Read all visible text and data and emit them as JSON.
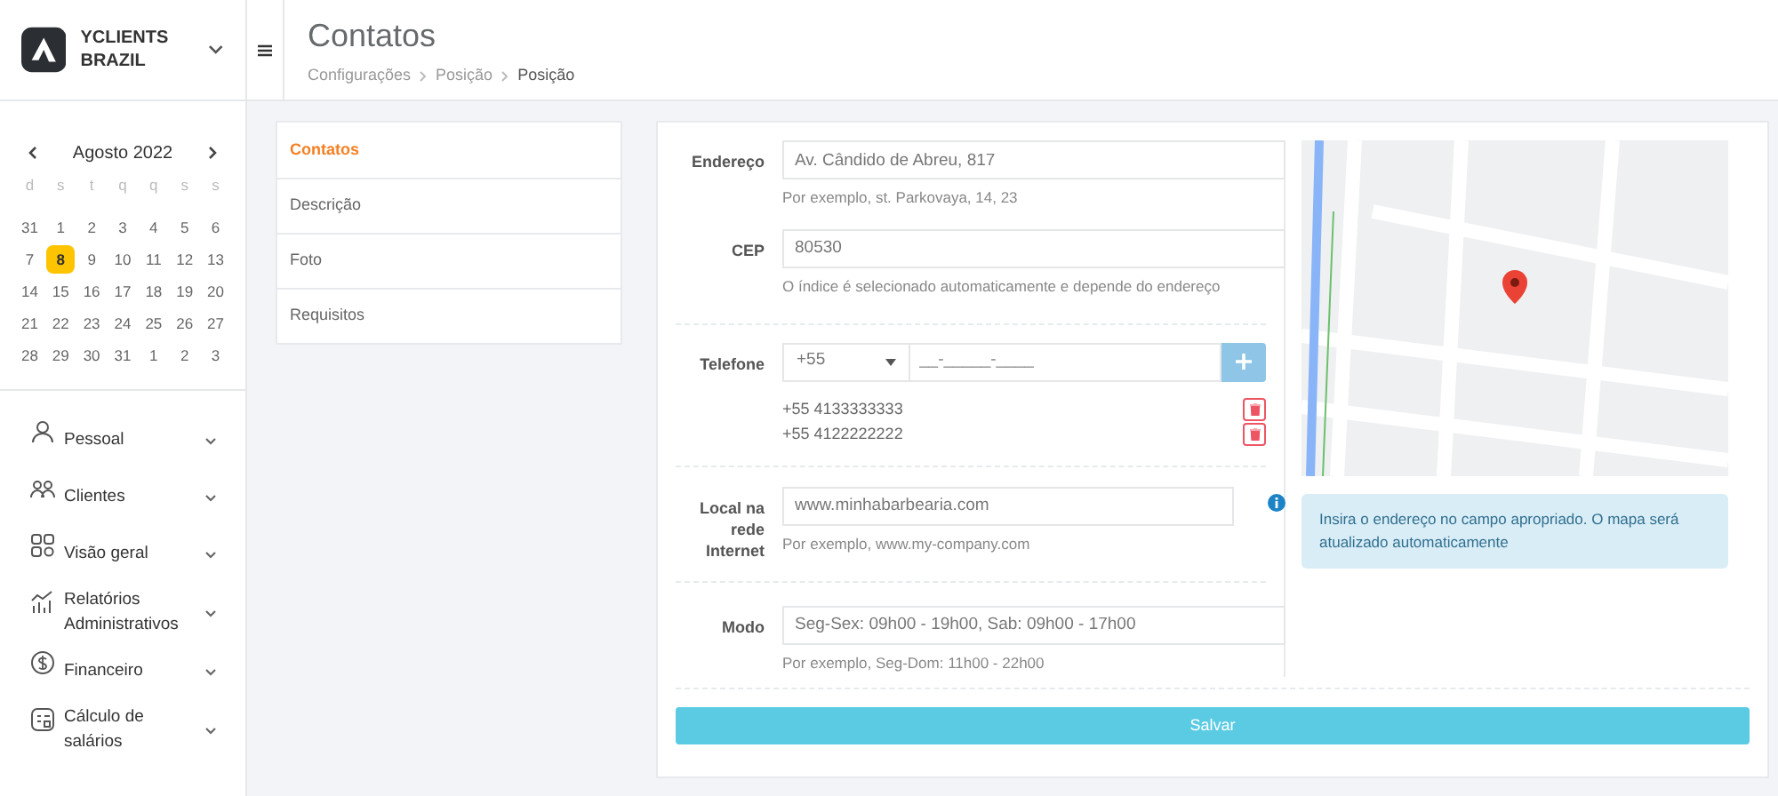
{
  "brand": {
    "name": "YCLIENTS BRAZIL"
  },
  "header": {
    "title": "Contatos",
    "breadcrumbs": [
      "Configurações",
      "Posição",
      "Posição"
    ]
  },
  "calendar": {
    "month": "Agosto 2022",
    "weekdays": [
      "d",
      "s",
      "t",
      "q",
      "q",
      "s",
      "s"
    ],
    "weeks": [
      [
        {
          "d": "31",
          "selected": false
        },
        {
          "d": "1",
          "selected": false
        },
        {
          "d": "2",
          "selected": false
        },
        {
          "d": "3",
          "selected": false
        },
        {
          "d": "4",
          "selected": false
        },
        {
          "d": "5",
          "selected": false
        },
        {
          "d": "6",
          "selected": false
        }
      ],
      [
        {
          "d": "7",
          "selected": false
        },
        {
          "d": "8",
          "selected": true
        },
        {
          "d": "9",
          "selected": false
        },
        {
          "d": "10",
          "selected": false
        },
        {
          "d": "11",
          "selected": false
        },
        {
          "d": "12",
          "selected": false
        },
        {
          "d": "13",
          "selected": false
        }
      ],
      [
        {
          "d": "14",
          "selected": false
        },
        {
          "d": "15",
          "selected": false
        },
        {
          "d": "16",
          "selected": false
        },
        {
          "d": "17",
          "selected": false
        },
        {
          "d": "18",
          "selected": false
        },
        {
          "d": "19",
          "selected": false
        },
        {
          "d": "20",
          "selected": false
        }
      ],
      [
        {
          "d": "21",
          "selected": false
        },
        {
          "d": "22",
          "selected": false
        },
        {
          "d": "23",
          "selected": false
        },
        {
          "d": "24",
          "selected": false
        },
        {
          "d": "25",
          "selected": false
        },
        {
          "d": "26",
          "selected": false
        },
        {
          "d": "27",
          "selected": false
        }
      ],
      [
        {
          "d": "28",
          "selected": false
        },
        {
          "d": "29",
          "selected": false
        },
        {
          "d": "30",
          "selected": false
        },
        {
          "d": "31",
          "selected": false
        },
        {
          "d": "1",
          "selected": false
        },
        {
          "d": "2",
          "selected": false
        },
        {
          "d": "3",
          "selected": false
        }
      ]
    ]
  },
  "sidebar": {
    "items": [
      {
        "label": "Pessoal"
      },
      {
        "label": "Clientes"
      },
      {
        "label": "Visão geral"
      },
      {
        "label": "Relatórios Administrativos"
      },
      {
        "label": "Financeiro"
      },
      {
        "label": "Cálculo de salários"
      }
    ]
  },
  "tabs": [
    {
      "label": "Contatos",
      "selected": true
    },
    {
      "label": "Descrição",
      "selected": false
    },
    {
      "label": "Foto",
      "selected": false
    },
    {
      "label": "Requisitos",
      "selected": false
    }
  ],
  "form": {
    "address": {
      "label": "Endereço",
      "value": "Av. Cândido de Abreu, 817",
      "hint": "Por exemplo, st. Parkovaya, 14, 23"
    },
    "zip": {
      "label": "CEP",
      "value": "80530",
      "hint": "O índice é selecionado automaticamente e depende do endereço"
    },
    "phone": {
      "label": "Telefone",
      "code": "+55",
      "placeholder": "__-_____-____",
      "numbers": [
        "+55 4133333333",
        "+55 4122222222"
      ]
    },
    "website": {
      "label": "Local na rede Internet",
      "value": "www.minhabarbearia.com",
      "hint": "Por exemplo, www.my-company.com"
    },
    "hours": {
      "label": "Modo",
      "value": "Seg-Sex: 09h00 - 19h00, Sab: 09h00 - 17h00",
      "hint": "Por exemplo, Seg-Dom: 11h00 - 22h00"
    },
    "save": "Salvar"
  },
  "map_notice": "Insira o endereço no campo apropriado. O mapa será atualizado automaticamente"
}
